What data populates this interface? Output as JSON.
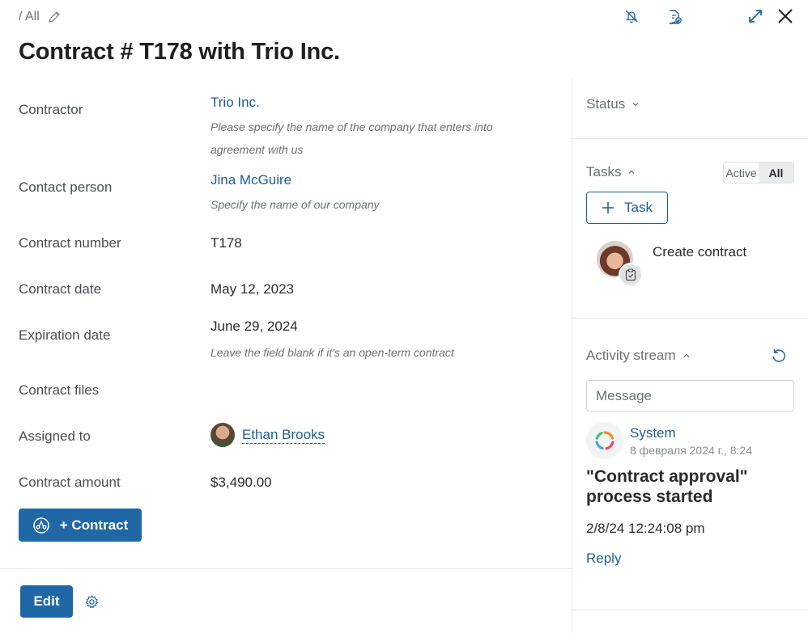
{
  "header": {
    "breadcrumb": "/ All",
    "title": "Contract # T178 with Trio Inc."
  },
  "fields": {
    "contractor": {
      "label": "Contractor",
      "value": "Trio Inc.",
      "hint": "Please specify the name of the company that enters into agreement with us"
    },
    "contact_person": {
      "label": "Contact person",
      "value": "Jina McGuire",
      "hint": "Specify the name of our company"
    },
    "contract_number": {
      "label": "Contract number",
      "value": "T178"
    },
    "contract_date": {
      "label": "Contract date",
      "value": "May 12, 2023"
    },
    "expiration_date": {
      "label": "Expiration date",
      "value": "June 29, 2024",
      "hint": "Leave the field blank if it's an open-term contract"
    },
    "contract_files": {
      "label": "Contract files"
    },
    "assigned_to": {
      "label": "Assigned to",
      "value": "Ethan Brooks"
    },
    "contract_amount": {
      "label": "Contract amount",
      "value": "$3,490.00"
    }
  },
  "actions": {
    "contract_button": "+ Contract",
    "edit_button": "Edit"
  },
  "sidebar": {
    "status_label": "Status",
    "tasks": {
      "label": "Tasks",
      "filter_active": "Active",
      "filter_all": "All",
      "add_task": "Task",
      "items": [
        {
          "name": "Create contract"
        }
      ]
    },
    "activity": {
      "label": "Activity stream",
      "message_placeholder": "Message",
      "event": {
        "author": "System",
        "time": "8 февраля 2024 г., 8:24",
        "title": "\"Contract approval\" process started",
        "body": "2/8/24 12:24:08 pm",
        "reply": "Reply"
      }
    }
  },
  "colors": {
    "accent": "#2067a6",
    "link": "#1e5e92",
    "border": "#e3e6e8"
  }
}
